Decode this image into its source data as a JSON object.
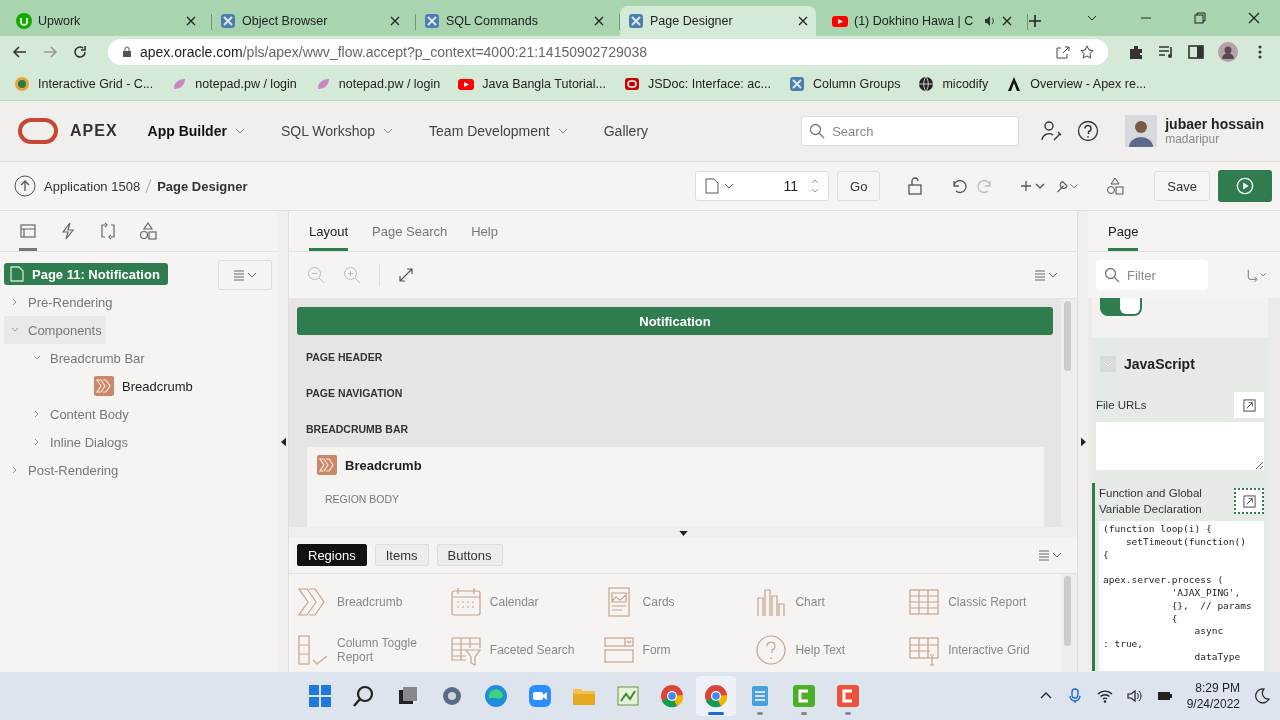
{
  "browser": {
    "tabs": [
      {
        "title": "Upwork",
        "kind": "round",
        "selected": false,
        "audio": false
      },
      {
        "title": "Object Browser",
        "kind": "app",
        "selected": false,
        "audio": false
      },
      {
        "title": "SQL Commands",
        "kind": "app",
        "selected": false,
        "audio": false
      },
      {
        "title": "Page Designer",
        "kind": "app",
        "selected": true,
        "audio": false
      },
      {
        "title": "(1) Dokhino Hawa | C",
        "kind": "video",
        "selected": false,
        "audio": true
      }
    ],
    "address_host": "apex.oracle.com",
    "address_path": "/pls/apex/wwv_flow.accept?p_context=4000:21:14150902729038",
    "bookmarks": [
      {
        "label": "Interactive Grid - C...",
        "kind": "swirl"
      },
      {
        "label": "notepad.pw / login",
        "kind": "leaf"
      },
      {
        "label": "notepad.pw / login",
        "kind": "leaf"
      },
      {
        "label": "Java Bangla Tutorial...",
        "kind": "video"
      },
      {
        "label": "JSDoc: Interface: ac...",
        "kind": "ring"
      },
      {
        "label": "Column Groups",
        "kind": "app"
      },
      {
        "label": "micodify",
        "kind": "globe"
      },
      {
        "label": "Overview - Apex re...",
        "kind": "letter"
      }
    ]
  },
  "header": {
    "logo": "APEX",
    "nav": [
      {
        "label": "App Builder",
        "selected": true,
        "menu": true
      },
      {
        "label": "SQL Workshop",
        "selected": false,
        "menu": true
      },
      {
        "label": "Team Development",
        "selected": false,
        "menu": true
      },
      {
        "label": "Gallery",
        "selected": false,
        "menu": false
      }
    ],
    "search": {
      "placeholder": "Search"
    },
    "user": {
      "name": "jubaer hossain",
      "subtitle": "madaripur"
    }
  },
  "toolbar": {
    "breadcrumb": [
      "Application 1508",
      "Page Designer"
    ],
    "page_number": "11",
    "go": "Go",
    "save": "Save"
  },
  "left": {
    "tabs": [
      {
        "kind": "rendering",
        "selected": true
      },
      {
        "kind": "dynamic",
        "selected": false
      },
      {
        "kind": "processing",
        "selected": false
      },
      {
        "kind": "shared",
        "selected": false
      }
    ],
    "tree": [
      {
        "label": "Page 11: Notification",
        "kind": "page",
        "selected": true,
        "hovered": false,
        "children": [
          {
            "label": "Pre-Rendering",
            "kind": "group",
            "expanded": false,
            "selected": false,
            "hovered": false
          },
          {
            "label": "Components",
            "kind": "group",
            "expanded": true,
            "selected": false,
            "hovered": true,
            "children": [
              {
                "label": "Breadcrumb Bar",
                "kind": "group",
                "expanded": true,
                "selected": false,
                "hovered": false,
                "children": [
                  {
                    "label": "Breadcrumb",
                    "kind": "region",
                    "selected": false,
                    "hovered": false
                  }
                ]
              },
              {
                "label": "Content Body",
                "kind": "group",
                "expanded": false,
                "selected": false,
                "hovered": false
              },
              {
                "label": "Inline Dialogs",
                "kind": "group",
                "expanded": false,
                "selected": false,
                "hovered": false
              }
            ]
          },
          {
            "label": "Post-Rendering",
            "kind": "group",
            "expanded": false,
            "selected": false,
            "hovered": false
          }
        ]
      }
    ]
  },
  "center": {
    "tabs": [
      {
        "label": "Layout",
        "selected": true
      },
      {
        "label": "Page Search",
        "selected": false
      },
      {
        "label": "Help",
        "selected": false
      }
    ],
    "page_title": "Notification",
    "sections": [
      {
        "label": "PAGE HEADER"
      },
      {
        "label": "PAGE NAVIGATION"
      },
      {
        "label": "BREADCRUMB BAR",
        "region": "Breadcrumb",
        "body": "REGION BODY"
      }
    ],
    "gallery_tabs": [
      {
        "label": "Regions",
        "selected": true
      },
      {
        "label": "Items",
        "selected": false
      },
      {
        "label": "Buttons",
        "selected": false
      }
    ],
    "gallery": [
      {
        "label": "Breadcrumb",
        "kind": "breadcrumb"
      },
      {
        "label": "Calendar",
        "kind": "calendar"
      },
      {
        "label": "Cards",
        "kind": "cards"
      },
      {
        "label": "Chart",
        "kind": "chart"
      },
      {
        "label": "Classic Report",
        "kind": "table"
      },
      {
        "label": "Column Toggle Report",
        "kind": "toggle"
      },
      {
        "label": "Faceted Search",
        "kind": "facet"
      },
      {
        "label": "Form",
        "kind": "form"
      },
      {
        "label": "Help Text",
        "kind": "help"
      },
      {
        "label": "Interactive Grid",
        "kind": "grid"
      }
    ]
  },
  "right": {
    "tab": "Page",
    "filter": {
      "placeholder": "Filter"
    },
    "toggle": {
      "on": true
    },
    "section": {
      "title": "JavaScript",
      "expanded": true
    },
    "file_urls": {
      "label": "File URLs"
    },
    "function_decl": {
      "label": "Function and Global Variable Declaration",
      "focused": true,
      "code": "(function loop(i) {\n    setTimeout(function()\n{\n\napex.server.process (\n            'AJAX_PING',\n            {},  // params\n            {\n                async\n: true,\n                dataType"
    }
  },
  "taskbar": {
    "apps": [
      {
        "kind": "start",
        "running": false,
        "selected": false
      },
      {
        "kind": "search",
        "running": false,
        "selected": false
      },
      {
        "kind": "taskview",
        "running": false,
        "selected": false
      },
      {
        "kind": "settings",
        "running": false,
        "selected": false
      },
      {
        "kind": "edge",
        "running": false,
        "selected": false
      },
      {
        "kind": "zoom",
        "running": false,
        "selected": false
      },
      {
        "kind": "folder",
        "running": false,
        "selected": false
      },
      {
        "kind": "paint",
        "running": false,
        "selected": false
      },
      {
        "kind": "chrome",
        "running": false,
        "selected": false
      },
      {
        "kind": "chrome",
        "running": true,
        "selected": true
      },
      {
        "kind": "notepad",
        "running": true,
        "selected": false
      },
      {
        "kind": "recorder",
        "running": true,
        "selected": false
      },
      {
        "kind": "editor",
        "running": true,
        "selected": false
      }
    ],
    "time": "8:29 PM",
    "date": "9/24/2022"
  }
}
